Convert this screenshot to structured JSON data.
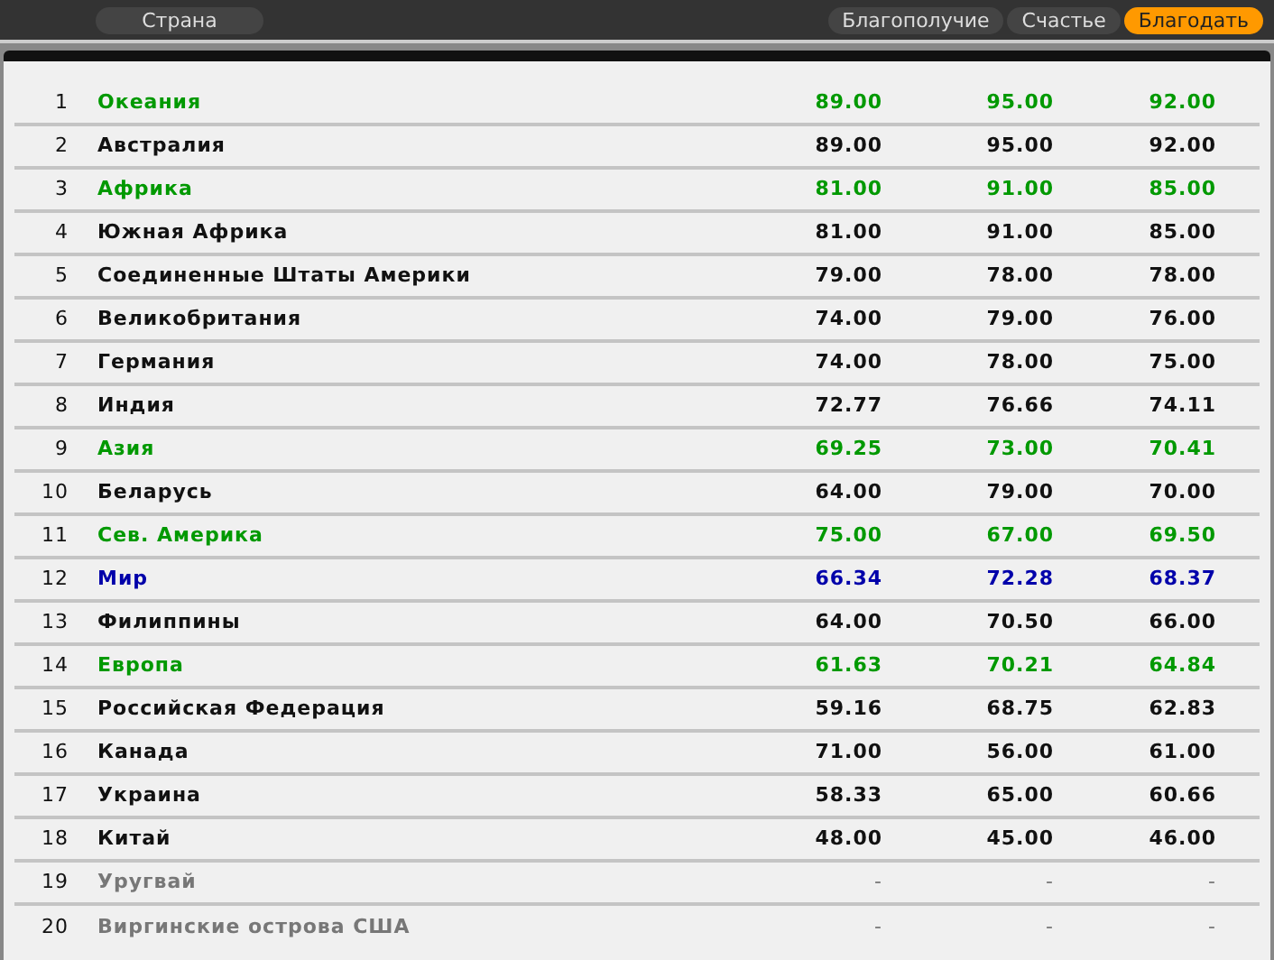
{
  "column_tab": {
    "label": "Страна",
    "selected": false
  },
  "metric_tabs": [
    {
      "label": "Благополучие",
      "selected": false
    },
    {
      "label": "Счастье",
      "selected": false
    },
    {
      "label": "Благодать",
      "selected": true
    }
  ],
  "table": {
    "rows": [
      {
        "rank": "1",
        "name": "Океания",
        "kind": "region",
        "values": [
          "89.00",
          "95.00",
          "92.00"
        ]
      },
      {
        "rank": "2",
        "name": "Австралия",
        "kind": "country",
        "values": [
          "89.00",
          "95.00",
          "92.00"
        ]
      },
      {
        "rank": "3",
        "name": "Африка",
        "kind": "region",
        "values": [
          "81.00",
          "91.00",
          "85.00"
        ]
      },
      {
        "rank": "4",
        "name": "Южная Африка",
        "kind": "country",
        "values": [
          "81.00",
          "91.00",
          "85.00"
        ]
      },
      {
        "rank": "5",
        "name": "Соединенные Штаты Америки",
        "kind": "country",
        "values": [
          "79.00",
          "78.00",
          "78.00"
        ]
      },
      {
        "rank": "6",
        "name": "Великобритания",
        "kind": "country",
        "values": [
          "74.00",
          "79.00",
          "76.00"
        ]
      },
      {
        "rank": "7",
        "name": "Германия",
        "kind": "country",
        "values": [
          "74.00",
          "78.00",
          "75.00"
        ]
      },
      {
        "rank": "8",
        "name": "Индия",
        "kind": "country",
        "values": [
          "72.77",
          "76.66",
          "74.11"
        ]
      },
      {
        "rank": "9",
        "name": "Азия",
        "kind": "region",
        "values": [
          "69.25",
          "73.00",
          "70.41"
        ]
      },
      {
        "rank": "10",
        "name": "Беларусь",
        "kind": "country",
        "values": [
          "64.00",
          "79.00",
          "70.00"
        ]
      },
      {
        "rank": "11",
        "name": "Сев. Америка",
        "kind": "region",
        "values": [
          "75.00",
          "67.00",
          "69.50"
        ]
      },
      {
        "rank": "12",
        "name": "Мир",
        "kind": "world",
        "values": [
          "66.34",
          "72.28",
          "68.37"
        ]
      },
      {
        "rank": "13",
        "name": "Филиппины",
        "kind": "country",
        "values": [
          "64.00",
          "70.50",
          "66.00"
        ]
      },
      {
        "rank": "14",
        "name": "Европа",
        "kind": "region",
        "values": [
          "61.63",
          "70.21",
          "64.84"
        ]
      },
      {
        "rank": "15",
        "name": "Российская Федерация",
        "kind": "country",
        "values": [
          "59.16",
          "68.75",
          "62.83"
        ]
      },
      {
        "rank": "16",
        "name": "Канада",
        "kind": "country",
        "values": [
          "71.00",
          "56.00",
          "61.00"
        ]
      },
      {
        "rank": "17",
        "name": "Украина",
        "kind": "country",
        "values": [
          "58.33",
          "65.00",
          "60.66"
        ]
      },
      {
        "rank": "18",
        "name": "Китай",
        "kind": "country",
        "values": [
          "48.00",
          "45.00",
          "46.00"
        ]
      },
      {
        "rank": "19",
        "name": "Уругвай",
        "kind": "nodata",
        "values": [
          "-",
          "-",
          "-"
        ]
      },
      {
        "rank": "20",
        "name": "Виргинские острова США",
        "kind": "nodata",
        "values": [
          "-",
          "-",
          "-"
        ]
      }
    ]
  }
}
